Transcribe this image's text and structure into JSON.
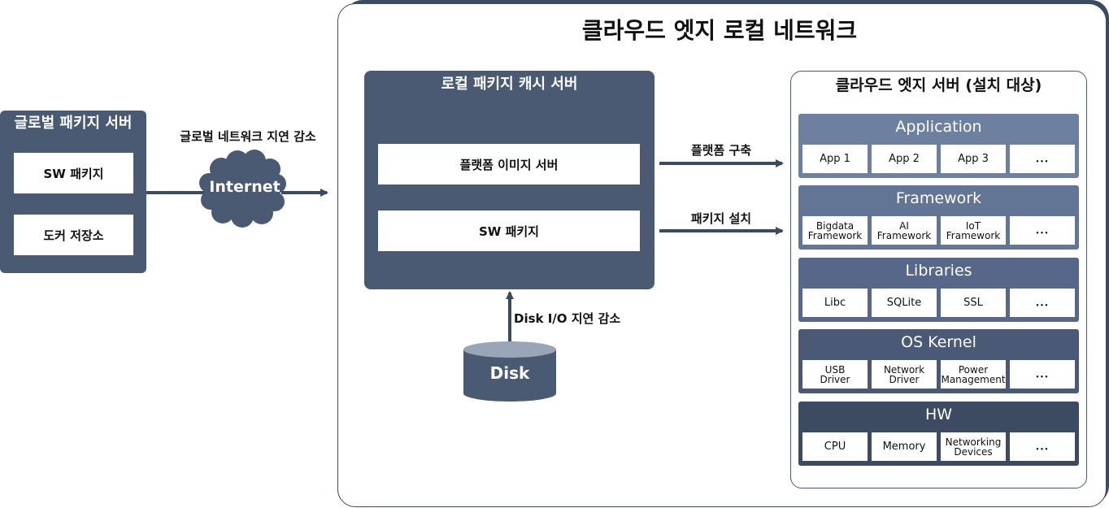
{
  "title": "클라우드 엣지 로컬 네트워크",
  "global_server": {
    "title": "글로벌 패키지 서버",
    "items": [
      "SW 패키지",
      "도커 저장소"
    ]
  },
  "internet": {
    "label": "글로벌 네트워크 지연 감소",
    "cloud_text": "Internet"
  },
  "cache_server": {
    "title": "로컬 패키지 캐시 서버",
    "items": [
      "플랫폼 이미지 서버",
      "SW 패키지"
    ]
  },
  "arrows": {
    "build": "플랫폼 구축",
    "install": "패키지 설치",
    "disk_io": "Disk I/O 지연 감소"
  },
  "disk": {
    "label": "Disk"
  },
  "edge_server": {
    "title": "클라우드 엣지 서버 (설치 대상)",
    "layers": [
      {
        "name": "Application",
        "color": "#6e80a0",
        "cells": [
          "App 1",
          "App 2",
          "App 3",
          "..."
        ]
      },
      {
        "name": "Framework",
        "color": "#637595",
        "cells": [
          "Bigdata\nFramework",
          "AI\nFramework",
          "IoT\nFramework",
          "..."
        ]
      },
      {
        "name": "Libraries",
        "color": "#56678a",
        "cells": [
          "Libc",
          "SQLite",
          "SSL",
          "..."
        ]
      },
      {
        "name": "OS Kernel",
        "color": "#4a5a76",
        "cells": [
          "USB\nDriver",
          "Network\nDriver",
          "Power\nManagement",
          "..."
        ]
      },
      {
        "name": "HW",
        "color": "#3c4a62",
        "cells": [
          "CPU",
          "Memory",
          "Networking\nDevices",
          "..."
        ]
      }
    ]
  },
  "colors": {
    "primary": "#4a5a72",
    "frame": "#3a4a62",
    "disk_top": "#9aa6b8"
  }
}
